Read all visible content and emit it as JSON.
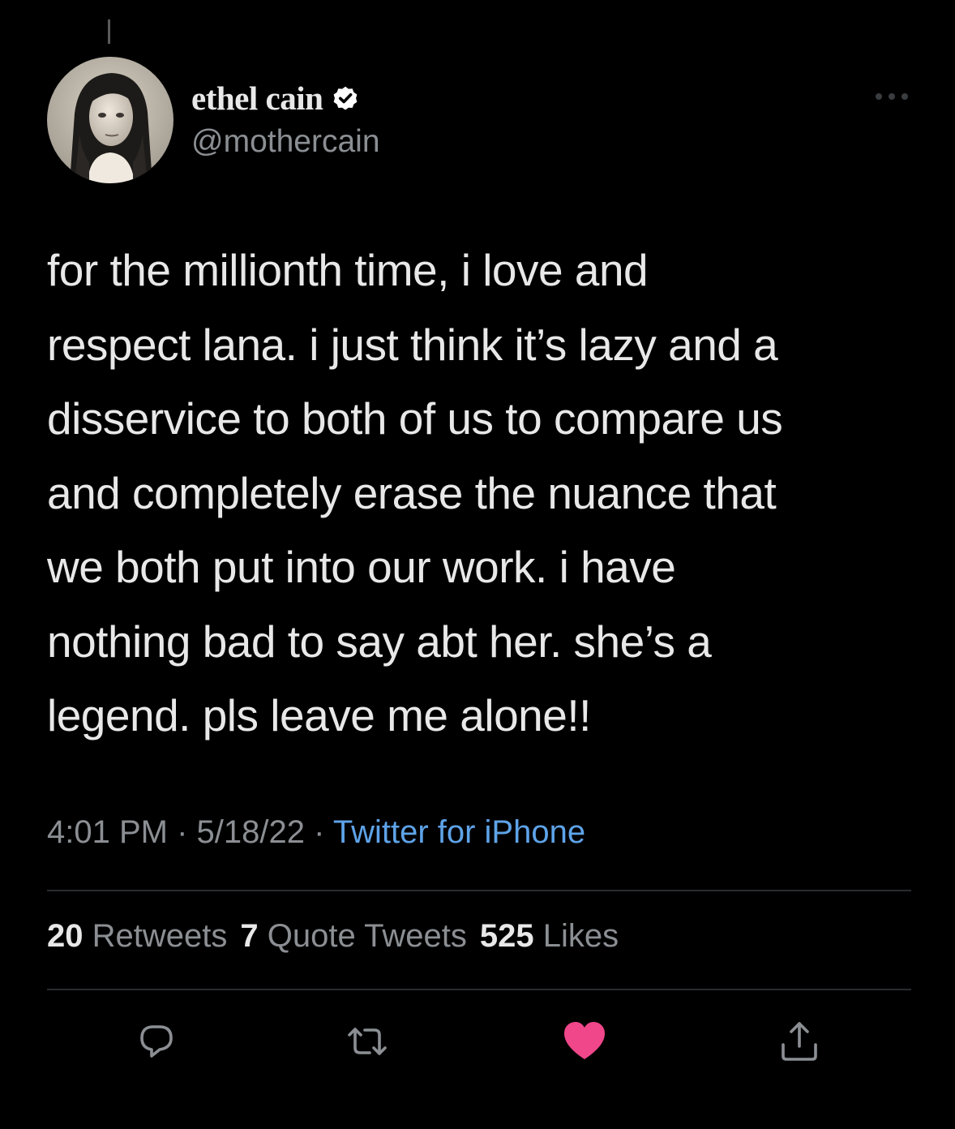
{
  "author": {
    "display_name": "ethel cain",
    "handle": "@mothercain",
    "verified": true,
    "avatar_icon": "profile-photo"
  },
  "tweet": {
    "text_lines": [
      "for the millionth time, i love and",
      "respect lana. i just think it’s lazy and a",
      "disservice to both of us to compare us",
      "and completely erase the nuance that",
      "we both put into our work. i have",
      "nothing bad to say abt her. she’s a",
      "legend. pls leave me alone!!"
    ],
    "time": "4:01 PM",
    "date": "5/18/22",
    "separator": "·",
    "source": "Twitter for iPhone"
  },
  "stats": {
    "retweets_count": "20",
    "retweets_label": "Retweets",
    "quotes_count": "7",
    "quotes_label": "Quote Tweets",
    "likes_count": "525",
    "likes_label": "Likes"
  },
  "actions": {
    "reply_icon": "reply-icon",
    "retweet_icon": "retweet-icon",
    "like_icon": "heart-icon",
    "share_icon": "share-icon",
    "liked": true
  },
  "colors": {
    "background": "#000000",
    "text": "#e8e8e8",
    "muted": "#8b8f93",
    "link": "#5ea3e8",
    "like": "#f0468a",
    "verified_badge": "#ffffff"
  }
}
